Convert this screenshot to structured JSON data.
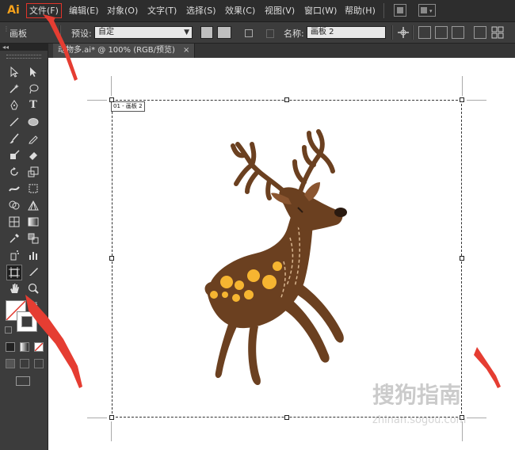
{
  "app": {
    "logo": "Ai"
  },
  "menu": {
    "items": [
      {
        "label": "文件(F)"
      },
      {
        "label": "编辑(E)"
      },
      {
        "label": "对象(O)"
      },
      {
        "label": "文字(T)"
      },
      {
        "label": "选择(S)"
      },
      {
        "label": "效果(C)"
      },
      {
        "label": "视图(V)"
      },
      {
        "label": "窗口(W)"
      },
      {
        "label": "帮助(H)"
      }
    ]
  },
  "controlbar": {
    "panel_title": "画板",
    "preset_label": "预设:",
    "preset_value": "自定",
    "name_label": "名称:",
    "name_value": "画板 2"
  },
  "tools": {
    "collapse": "◂◂"
  },
  "document": {
    "tab_title": "动物多.ai* @ 100% (RGB/预览)",
    "tab_close": "×",
    "artboard_label": "01 - 画板 2"
  },
  "watermark": {
    "main": "搜狗指南",
    "sub": "zhinan.sogou.com"
  },
  "colors": {
    "highlight": "#e0342a",
    "annotation_arrow": "#e53d32",
    "deer_body": "#6b4020",
    "deer_spots": "#f6b531"
  }
}
